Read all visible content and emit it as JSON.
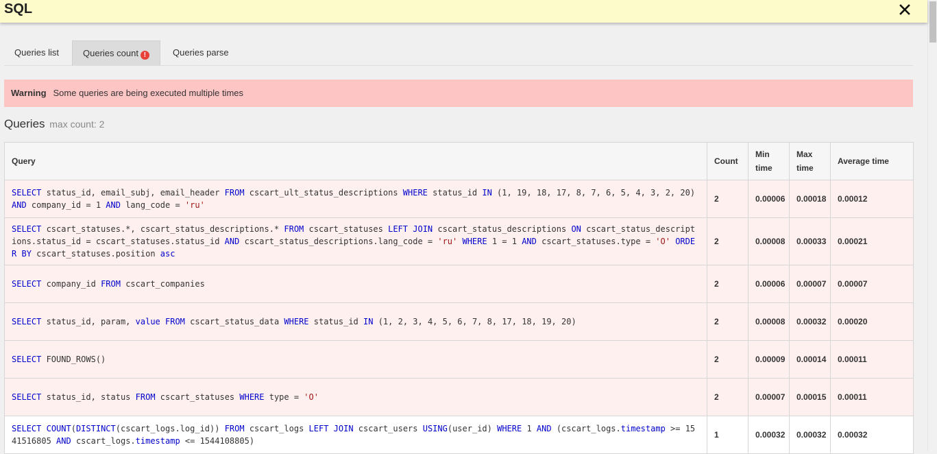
{
  "panel": {
    "title": "SQL",
    "close_icon": "close-icon"
  },
  "tabs": [
    {
      "label": "Queries list",
      "active": false
    },
    {
      "label": "Queries count",
      "active": true,
      "badge": "!"
    },
    {
      "label": "Queries parse",
      "active": false
    }
  ],
  "warning": {
    "label": "Warning",
    "text": "Some queries are being executed multiple times"
  },
  "heading": {
    "title": "Queries",
    "subtitle": "max count: 2"
  },
  "table": {
    "headers": {
      "query": "Query",
      "count": "Count",
      "min": "Min time",
      "max": "Max time",
      "avg": "Average time"
    },
    "rows": [
      {
        "query": "SELECT status_id, email_subj, email_header FROM cscart_ult_status_descriptions WHERE status_id IN (1, 19, 18, 17, 8, 7, 6, 5, 4, 3, 2, 20) AND company_id = 1 AND lang_code = 'ru'",
        "count": "2",
        "min": "0.00006",
        "max": "0.00018",
        "avg": "0.00012",
        "duplicate": true
      },
      {
        "query": "SELECT cscart_statuses.*, cscart_status_descriptions.* FROM cscart_statuses LEFT JOIN cscart_status_descriptions ON cscart_status_descriptions.status_id = cscart_statuses.status_id AND cscart_status_descriptions.lang_code = 'ru' WHERE 1 = 1 AND cscart_statuses.type = 'O' ORDER BY cscart_statuses.position asc",
        "count": "2",
        "min": "0.00008",
        "max": "0.00033",
        "avg": "0.00021",
        "duplicate": true
      },
      {
        "query": "SELECT company_id FROM cscart_companies",
        "count": "2",
        "min": "0.00006",
        "max": "0.00007",
        "avg": "0.00007",
        "duplicate": true
      },
      {
        "query": "SELECT status_id, param, value FROM cscart_status_data WHERE status_id IN (1, 2, 3, 4, 5, 6, 7, 8, 17, 18, 19, 20)",
        "count": "2",
        "min": "0.00008",
        "max": "0.00032",
        "avg": "0.00020",
        "duplicate": true
      },
      {
        "query": "SELECT FOUND_ROWS()",
        "count": "2",
        "min": "0.00009",
        "max": "0.00014",
        "avg": "0.00011",
        "duplicate": true
      },
      {
        "query": "SELECT status_id, status FROM cscart_statuses WHERE type = 'O'",
        "count": "2",
        "min": "0.00007",
        "max": "0.00015",
        "avg": "0.00011",
        "duplicate": true
      },
      {
        "query": "SELECT COUNT(DISTINCT(cscart_logs.log_id)) FROM cscart_logs LEFT JOIN cscart_users USING(user_id) WHERE 1 AND (cscart_logs.timestamp >= 1541516805 AND cscart_logs.timestamp <= 1544108805)",
        "count": "1",
        "min": "0.00032",
        "max": "0.00032",
        "avg": "0.00032",
        "duplicate": false
      }
    ]
  },
  "colors": {
    "titlebar": "#fdfbc9",
    "warning_bg": "#fec5c5",
    "badge": "#e8413a",
    "keyword": "#0000cc",
    "string": "#a31515",
    "dup_row": "#fff0f0"
  }
}
